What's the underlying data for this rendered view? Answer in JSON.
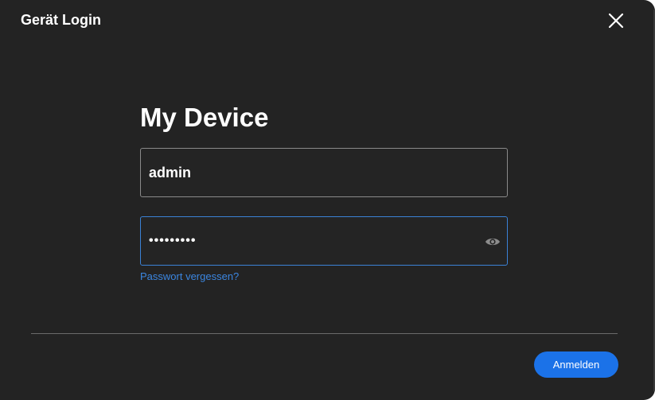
{
  "dialog": {
    "title": "Gerät Login",
    "close_icon": "close-icon"
  },
  "form": {
    "heading": "My Device",
    "username": {
      "value": "admin"
    },
    "password": {
      "value": "•••••••••",
      "visibility_icon": "eye-icon"
    },
    "forgot_link": "Passwort vergessen?"
  },
  "footer": {
    "login_label": "Anmelden"
  },
  "colors": {
    "background": "#232323",
    "accent": "#1b72e8",
    "link": "#3b86e0",
    "focus_border": "#3b82d6"
  }
}
